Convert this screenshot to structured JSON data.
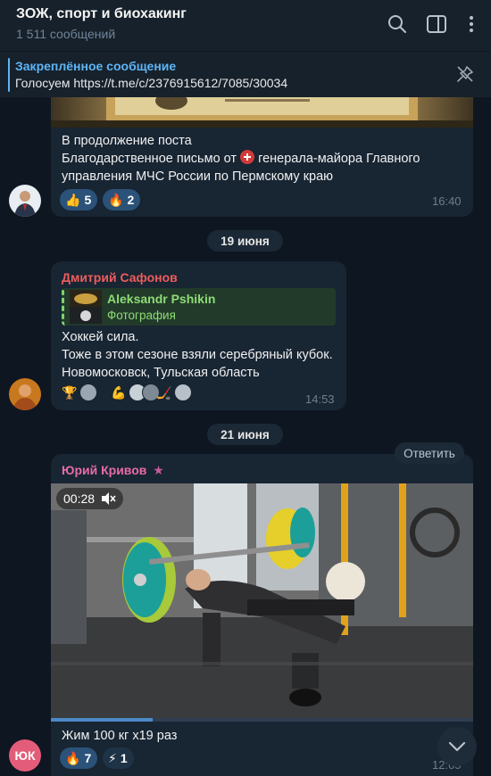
{
  "header": {
    "title": "ЗОЖ, спорт и биохакинг",
    "subtitle": "1 511 сообщений",
    "icons": [
      "search-icon",
      "sidebar-toggle-icon",
      "more-vertical-icon"
    ]
  },
  "pinned": {
    "title": "Закреплённое сообщение",
    "text": "Голосуем  https://t.me/c/2376915612/7085/30034",
    "icon": "unpin-icon"
  },
  "messages": [
    {
      "text_line1": "В продолжение поста",
      "text_line2_a": "Благодарственное письмо от ",
      "text_line2_b": " генерала-майора Главного",
      "text_line3": "управления МЧС России по Пермскому краю",
      "reactions": [
        {
          "emoji": "👍",
          "count": "5"
        },
        {
          "emoji": "🔥",
          "count": "2"
        }
      ],
      "time": "16:40"
    },
    {
      "date": "19 июня",
      "sender": "Дмитрий Сафонов",
      "sender_color": "#ee5c5c",
      "quote": {
        "name": "Aleksandr Pshikin",
        "type": "Фотография"
      },
      "text_line1": "Хоккей сила.",
      "text_line2": "Тоже в этом сезоне взяли серебряный кубок.",
      "text_line3": "Новомосковск, Тульская область",
      "reactions": [
        {
          "emoji": "🏆"
        },
        {
          "emoji": "💪"
        },
        {
          "emoji": "🏒"
        }
      ],
      "time": "14:53"
    },
    {
      "date": "21 июня",
      "reply_label": "Ответить",
      "sender": "Юрий Кривов",
      "sender_color": "#e86ca6",
      "sender_star": "★",
      "video": {
        "duration": "00:28",
        "muted": true,
        "progress": 0.24
      },
      "caption": "Жим 100 кг x19 раз",
      "reactions": [
        {
          "emoji": "🔥",
          "count": "7"
        },
        {
          "emoji": "⚡",
          "count": "1"
        }
      ],
      "time": "12:05",
      "avatar_initials": "ЮК"
    }
  ]
}
